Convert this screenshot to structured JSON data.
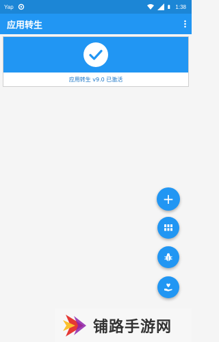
{
  "status_bar": {
    "left_text": "Yap",
    "time": "1:38"
  },
  "app_bar": {
    "title": "应用转生",
    "menu_icon": "more-vert-icon"
  },
  "status_card": {
    "icon": "check-icon",
    "text": "应用转生 v9.0 已激活"
  },
  "fab_actions": [
    {
      "name": "add-fab",
      "icon": "plus-icon",
      "glyph": "+"
    },
    {
      "name": "apps-grid-fab",
      "icon": "grid-icon"
    },
    {
      "name": "bug-fab",
      "icon": "bug-icon"
    },
    {
      "name": "donate-fab",
      "icon": "heart-hand-icon"
    }
  ],
  "watermark": {
    "text": "铺路手游网"
  },
  "colors": {
    "primary": "#2196f3",
    "status_bar": "#1c86d6",
    "background": "#f5f5f5"
  }
}
